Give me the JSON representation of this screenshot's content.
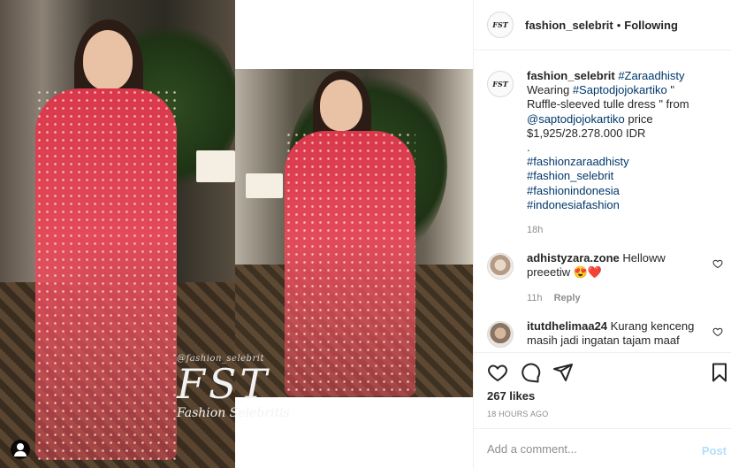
{
  "post": {
    "username": "fashion_selebrit",
    "separator": "•",
    "follow_status": "Following",
    "avatar_logo_text": "FST"
  },
  "watermark": {
    "small": "@fashion_selebrit",
    "big": "FST",
    "sub": "Fashion Selebritis"
  },
  "caption": {
    "username": "fashion_selebrit",
    "hashtag1": "#Zaraadhisty",
    "text1": "Wearing",
    "hashtag2": "#Saptodjojokartiko",
    "text2": "\" Ruffle-sleeved tulle dress \" from",
    "mention": "@saptodjojokartiko",
    "text3": "price $1,925/28.278.000 IDR",
    "dot": ".",
    "tag_a": "#fashionzaraadhisty",
    "tag_b": "#fashion_selebrit",
    "tag_c": "#fashionindonesia",
    "tag_d": "#indonesiafashion",
    "time": "18h"
  },
  "comments": [
    {
      "username": "adhistyzara.zone",
      "text": "Helloww preeetiw 😍❤️",
      "time": "11h",
      "reply": "Reply"
    },
    {
      "username": "itutdhelimaa24",
      "text": "Kurang kenceng masih jadi ingatan tajam maaf"
    }
  ],
  "engagement": {
    "likes": "267 likes",
    "posted": "18 HOURS AGO"
  },
  "add_comment": {
    "placeholder": "Add a comment...",
    "post_label": "Post"
  },
  "colors": {
    "link": "#00376b",
    "muted": "#8e8e8e",
    "post_disabled": "#b2dffc",
    "dress": "#e34a5a"
  }
}
